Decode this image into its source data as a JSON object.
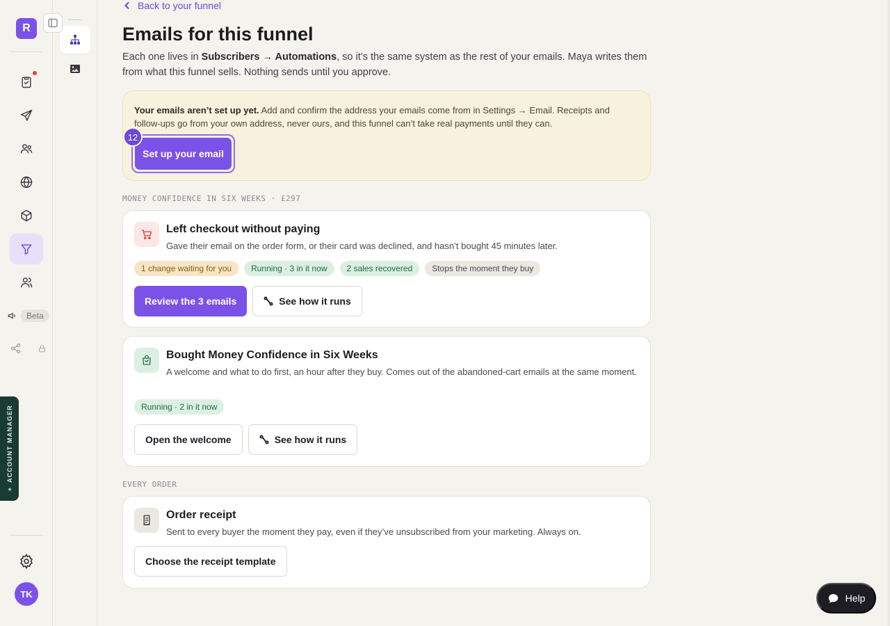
{
  "rail": {
    "logo_letter": "R",
    "beta_label": "Beta",
    "avatar_initials": "TK",
    "account_tab_label": "ACCOUNT MANAGER",
    "nav_items": [
      "checklist-icon",
      "send-icon",
      "people-icon",
      "globe-icon",
      "box-icon",
      "funnel-icon",
      "users-icon"
    ],
    "active_item": "funnel-icon"
  },
  "subrail": {
    "items": [
      "sitemap-icon",
      "image-icon"
    ],
    "active_item": "sitemap-icon"
  },
  "page": {
    "back_link": "Back to your funnel",
    "title": "Emails for this funnel",
    "intro_1": "Each one lives in ",
    "intro_bold_1": "Subscribers → Automations",
    "intro_2": ", so it’s the same system as the rest of your emails. Maya writes them from what this funnel sells. Nothing sends until you approve."
  },
  "warning": {
    "bold": "Your emails aren’t set up yet.",
    "text": " Add and confirm the address your emails come from in Settings → Email. Receipts and follow-ups go from your own address, never ours, and this funnel can’t take real payments until they can.",
    "button": "Set up your email",
    "step_badge": "12"
  },
  "section_product": "MONEY CONFIDENCE IN SIX WEEKS · £297",
  "section_orders": "EVERY ORDER",
  "cards": {
    "abandoned": {
      "title": "Left checkout without paying",
      "desc": "Gave their email on the order form, or their card was declined, and hasn’t bought 45 minutes later.",
      "pills": [
        "1 change waiting for you",
        "Running · 3 in it now",
        "2 sales recovered",
        "Stops the moment they buy"
      ],
      "primary_button": "Review the 3 emails",
      "secondary_button": "See how it runs"
    },
    "bought": {
      "title": "Bought Money Confidence in Six Weeks",
      "desc": "A welcome and what to do first, an hour after they buy. Comes out of the abandoned-cart emails at the same moment.",
      "pills": [
        "Running · 2 in it now"
      ],
      "primary_button": "Open the welcome",
      "secondary_button": "See how it runs"
    },
    "receipt": {
      "title": "Order receipt",
      "desc": "Sent to every buyer the moment they pay, even if they’ve unsubscribed from your marketing. Always on.",
      "button": "Choose the receipt template"
    }
  },
  "help_button": "Help",
  "colors": {
    "accent": "#7b52e8",
    "background": "#f5f3ee",
    "warning_bg": "#f8f1dd",
    "pill_amber": "#f7e6c6",
    "pill_green": "#dcefe3"
  }
}
